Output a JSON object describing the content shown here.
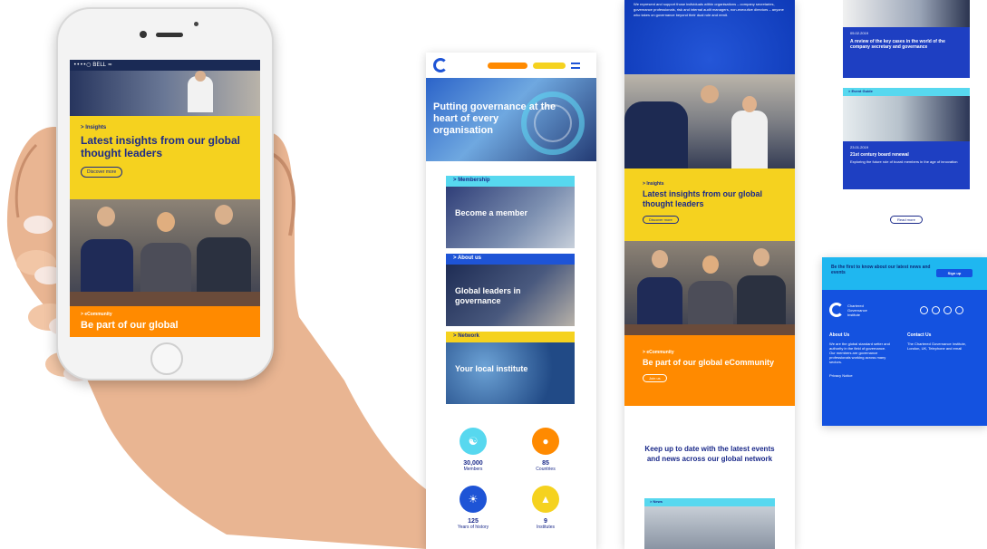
{
  "phone": {
    "status_bar": "••••○ BELL  ≈",
    "insights_kicker": "Insights",
    "insights_title": "Latest insights from our global thought leaders",
    "insights_button": "Discover more",
    "community_kicker": "eCommunity",
    "community_title": "Be part of our global"
  },
  "col1": {
    "hero_title": "Putting governance at the heart of every organisation",
    "cards": [
      {
        "tag": "Membership",
        "title": "Become a member"
      },
      {
        "tag": "About us",
        "title": "Global leaders in governance"
      },
      {
        "tag": "Network",
        "title": "Your local institute"
      }
    ],
    "stats": [
      {
        "number": "30,000",
        "label": "Members"
      },
      {
        "number": "85",
        "label": "Countries"
      },
      {
        "number": "125",
        "label": "Years of history"
      },
      {
        "number": "9",
        "label": "Institutes"
      }
    ]
  },
  "col2": {
    "top_text": "We represent and support those individuals within organisations – company secretaries, governance professionals, risk and internal audit managers, non-executive directors – anyone who takes on governance beyond their dual role and remit.",
    "insights_kicker": "Insights",
    "insights_title": "Latest insights from our global thought leaders",
    "insights_button": "Discover more",
    "community_kicker": "eCommunity",
    "community_title": "Be part of our global eCommunity",
    "community_button": "Join us",
    "keep_title": "Keep up to date with the latest events and news across our global network",
    "news_tag": "News"
  },
  "col3": {
    "card1_date": "05.02.2019",
    "card1_title": "A review of the key cases in the world of the company secretary and governance",
    "card2_tag": "Event Guide",
    "card2_date": "23.01.2019",
    "card2_title": "21st century board renewal",
    "card2_text": "Exploring the future role of board members in the age of innovation",
    "read_more": "Read more",
    "footer_signup_text": "Be the first to know about our latest news and events",
    "footer_signup_button": "Sign up",
    "footer_logo_text": "Chartered Governance Institute",
    "footer_about_title": "About Us",
    "footer_about_text": "We are the global standard setter and authority in the field of governance. Our members are governance professionals working across many sectors.",
    "footer_contact_title": "Contact Us",
    "footer_contact_text": "The Chartered Governance Institute, London, UK, Telephone and email",
    "footer_privacy": "Privacy Notice"
  },
  "colors": {
    "brand_blue": "#1e54d6",
    "navy_text": "#1b2a8a",
    "yellow": "#f5d21f",
    "orange": "#ff8a00",
    "cyan": "#57d8ef"
  }
}
